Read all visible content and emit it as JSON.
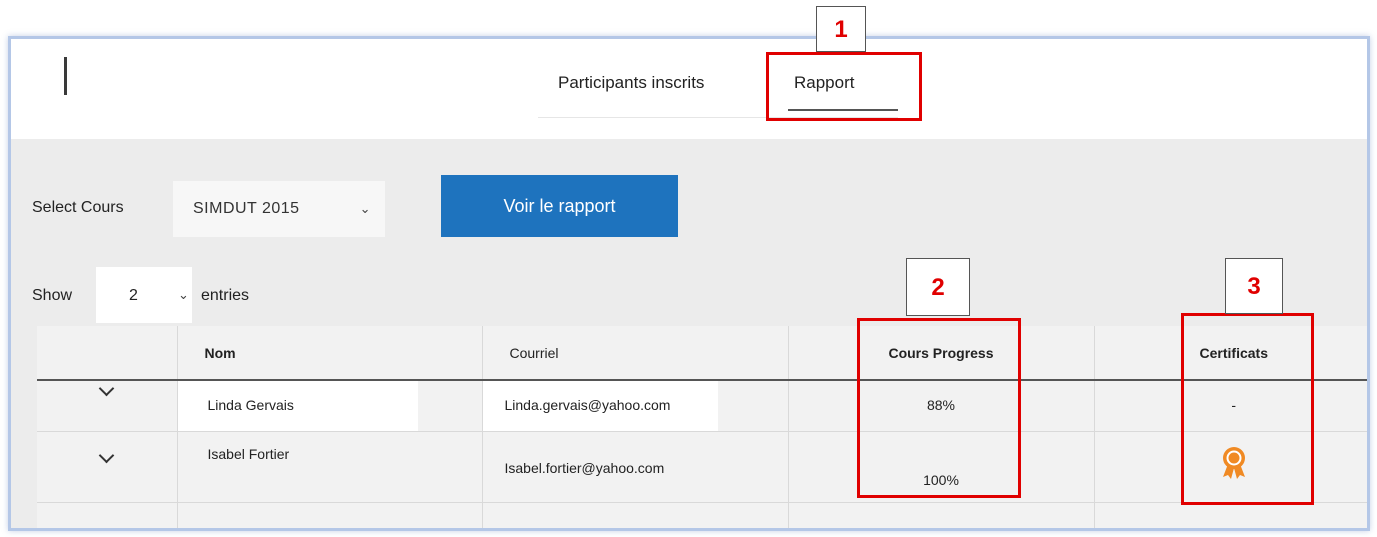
{
  "tabs": {
    "participants": "Participants inscrits",
    "rapport": "Rapport"
  },
  "filters": {
    "select_label": "Select Cours",
    "course_value": "SIMDUT 2015",
    "button_label": "Voir le rapport",
    "show_label": "Show",
    "entries_value": "2",
    "entries_label": "entries"
  },
  "table": {
    "columns": [
      "",
      "Nom",
      "Courriel",
      "Cours Progress",
      "Certificats"
    ],
    "rows": [
      {
        "name": "Linda Gervais",
        "email": "Linda.gervais@yahoo.com",
        "progress": "88%",
        "certificate": "-"
      },
      {
        "name": "Isabel Fortier",
        "email": "Isabel.fortier@yahoo.com",
        "progress": "100%",
        "certificate_icon": "award-ribbon-icon"
      }
    ]
  },
  "annotations": {
    "labels": [
      "1",
      "2",
      "3"
    ],
    "color": "#e00000"
  },
  "colors": {
    "button": "#1e73be",
    "panel": "#ececec",
    "certificate_icon": "#f08a24"
  }
}
